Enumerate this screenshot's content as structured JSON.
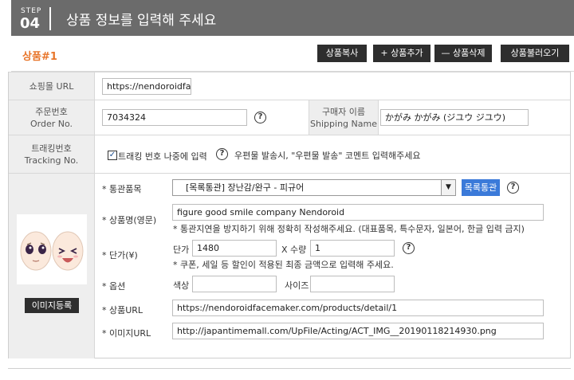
{
  "header": {
    "step_label": "STEP",
    "step_number": "04",
    "title": "상품 정보를 입력해 주세요"
  },
  "toolbar": {
    "product_tag": "상품#1",
    "copy_label": "상품복사",
    "add_label": "+ 상품추가",
    "delete_label": "— 상품삭제",
    "load_label": "상품불러오기"
  },
  "shop_url": {
    "label": "쇼핑몰 URL",
    "value": "https://nendoroidface"
  },
  "order": {
    "label_ko": "주문번호",
    "label_en": "Order No.",
    "value": "7034324",
    "buyer_label_ko": "구매자 이름",
    "buyer_label_en": "Shipping Name",
    "buyer_value": "かがみ かがみ (ジユウ ジユウ)"
  },
  "tracking": {
    "label_ko": "트래킹번호",
    "label_en": "Tracking No.",
    "checkbox_label": "트래킹 번호 나중에 입력",
    "checked": true,
    "note": "우편물 발송시, \"우편물 발송\" 코멘트 입력해주세요"
  },
  "product": {
    "register_image_label": "이미지등록",
    "customs_label": "* 통관품목",
    "customs_value": "[목록통관] 장난감/완구 - 피규어",
    "customs_button": "목록통관",
    "name_label": "* 상품명(영문)",
    "name_value": "figure good smile company Nendoroid",
    "name_note": "* 통관지연을 방지하기 위해 정확히 작성해주세요. (대표품목, 특수문자, 일본어, 한글 입력 금지)",
    "price_label": "* 단가(¥)",
    "unit_price_label": "단가",
    "unit_price_value": "1480",
    "qty_label": "X 수량",
    "qty_value": "1",
    "price_note": "* 쿠폰, 세일 등 할인이 적용된 최종 금액으로 입력해 주세요.",
    "option_label": "* 옵션",
    "color_label": "색상",
    "color_value": "",
    "size_label": "사이즈",
    "size_value": "",
    "url_label": "* 상품URL",
    "url_value": "https://nendoroidfacemaker.com/products/detail/1",
    "image_url_label": "* 이미지URL",
    "image_url_value": "http://japantimemall.com/UpFile/Acting/ACT_IMG__20190118214930.png"
  },
  "colors": {
    "header_bg": "#6b6b6b",
    "accent_orange": "#e8752a",
    "button_dark": "#2e2e2e",
    "button_blue": "#3b7ad9"
  },
  "icons": {
    "help": "help-icon",
    "checkbox": "checkbox-icon",
    "dropdown": "chevron-down-icon"
  }
}
